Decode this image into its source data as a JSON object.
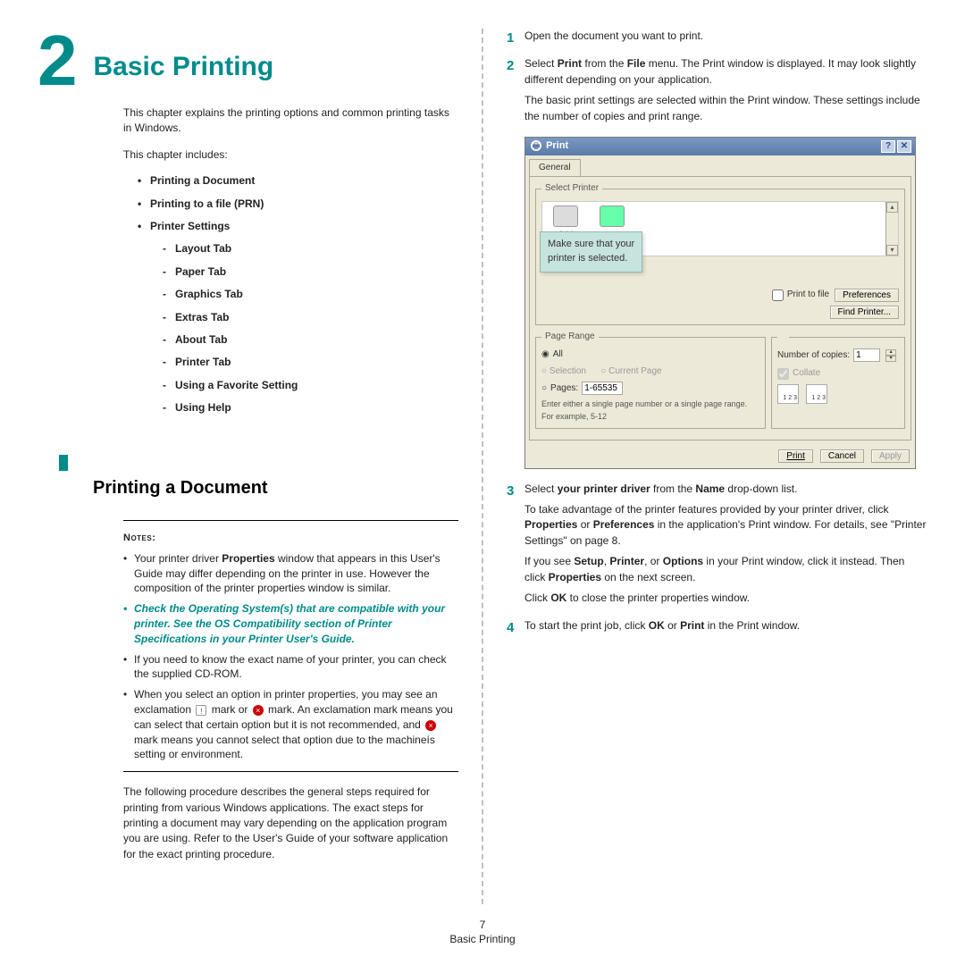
{
  "chapter": {
    "num": "2",
    "title": "Basic Printing"
  },
  "intro1": "This chapter explains the printing options and common printing tasks in Windows.",
  "intro2": "This chapter includes:",
  "toc": {
    "i1": "Printing a Document",
    "i2": "Printing to a file (PRN)",
    "i3": "Printer Settings",
    "s1": "Layout Tab",
    "s2": "Paper Tab",
    "s3": "Graphics Tab",
    "s4": "Extras Tab",
    "s5": "About Tab",
    "s6": "Printer Tab",
    "s7": "Using a Favorite Setting",
    "s8": "Using Help"
  },
  "section1": "Printing a Document",
  "notes": {
    "label": "Notes",
    "n1a": "Your printer driver ",
    "n1b": "Properties",
    "n1c": " window that appears in this User's Guide may differ depending on the printer in use. However the composition of the printer properties window is similar.",
    "n2": "Check the Operating System(s) that are compatible with your printer. See the OS Compatibility section of Printer Specifications in your Printer User's Guide.",
    "n3": "If you need to know the exact name of your printer, you can check the supplied CD-ROM.",
    "n4a": "When you select an option in printer properties, you may see an exclamation ",
    "n4b": " mark or ",
    "n4c": " mark. An exclamation mark means you can select that certain option but it is not recommended, and ",
    "n4d": " mark means you cannot select that option due to the machineís setting or environment."
  },
  "para_after_notes": "The following procedure describes the general steps required for printing from various Windows applications. The exact steps for printing a document may vary depending on the application program you are using. Refer to the User's Guide of your software application for the exact printing procedure.",
  "steps": {
    "s1": "Open the document you want to print.",
    "s2a": "Select ",
    "s2b": "Print",
    "s2c": " from the ",
    "s2d": "File",
    "s2e": " menu. The Print window is displayed. It may look slightly different depending on your application.",
    "s2p2": "The basic print settings are selected within the Print window. These settings include the number of copies and print range.",
    "s3a": "Select ",
    "s3b": "your printer driver",
    "s3c": " from the ",
    "s3d": "Name",
    "s3e": " drop-down list.",
    "s3p2a": "To take advantage of the printer features provided by your printer driver, click ",
    "s3p2b": "Properties",
    "s3p2c": " or ",
    "s3p2d": "Preferences",
    "s3p2e": " in the application's Print window. For details, see \"Printer Settings\" on page 8.",
    "s3p3a": "If you see ",
    "s3p3b": "Setup",
    "s3p3c": ", ",
    "s3p3d": "Printer",
    "s3p3e": ", or ",
    "s3p3f": "Options",
    "s3p3g": " in your Print window, click it instead. Then click ",
    "s3p3h": "Properties",
    "s3p3i": " on the next screen.",
    "s3p4a": "Click ",
    "s3p4b": "OK",
    "s3p4c": " to close the printer properties window.",
    "s4a": "To start the print job, click ",
    "s4b": "OK",
    "s4c": " or ",
    "s4d": "Print",
    "s4e": " in the Print window."
  },
  "dlg": {
    "title": "Print",
    "tab": "General",
    "group_select": "Select Printer",
    "add_printer": "Add Printer",
    "callout": "Make sure that your\nprinter is selected.",
    "print_to_file": "Print to file",
    "preferences": "Preferences",
    "find_printer": "Find Printer...",
    "group_range": "Page Range",
    "r_all": "All",
    "r_selection": "Selection",
    "r_current": "Current Page",
    "r_pages": "Pages:",
    "pages_val": "1-65535",
    "hint": "Enter either a single page number or a single page range. For example, 5-12",
    "num_copies": "Number of copies:",
    "copies_val": "1",
    "collate": "Collate",
    "btn_print": "Print",
    "btn_cancel": "Cancel",
    "btn_apply": "Apply"
  },
  "footer": {
    "pagenum": "7",
    "section": "Basic Printing"
  }
}
